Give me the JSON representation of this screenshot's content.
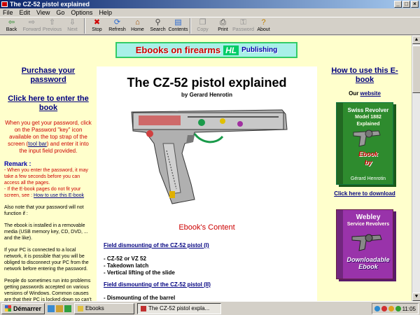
{
  "window": {
    "title": "The CZ-52 pistol explained"
  },
  "menu": [
    "File",
    "Edit",
    "View",
    "Go",
    "Options",
    "Help"
  ],
  "toolbar": [
    {
      "label": "Back",
      "icon": "back-icon",
      "glyph": "⇦",
      "color": "#2a8a2a",
      "enabled": true
    },
    {
      "label": "Forward",
      "icon": "forward-icon",
      "glyph": "⇨",
      "color": "#8c8c8c",
      "enabled": false
    },
    {
      "label": "Previous",
      "icon": "previous-icon",
      "glyph": "⇧",
      "color": "#8c8c8c",
      "enabled": false
    },
    {
      "label": "Next",
      "icon": "next-icon",
      "glyph": "⇩",
      "color": "#8c8c8c",
      "enabled": false
    },
    {
      "label": "Stop",
      "icon": "stop-icon",
      "glyph": "✖",
      "color": "#d00000",
      "enabled": true
    },
    {
      "label": "Refresh",
      "icon": "refresh-icon",
      "glyph": "⟳",
      "color": "#2a6ad0",
      "enabled": true
    },
    {
      "label": "Home",
      "icon": "home-icon",
      "glyph": "⌂",
      "color": "#a05000",
      "enabled": true
    },
    {
      "label": "Search",
      "icon": "search-icon",
      "glyph": "⚲",
      "color": "#404040",
      "enabled": true
    },
    {
      "label": "Contents",
      "icon": "contents-icon",
      "glyph": "▤",
      "color": "#2a6ad0",
      "enabled": true
    },
    {
      "label": "Copy",
      "icon": "copy-icon",
      "glyph": "❐",
      "color": "#8c8c8c",
      "enabled": false
    },
    {
      "label": "Print",
      "icon": "print-icon",
      "glyph": "⎙",
      "color": "#404040",
      "enabled": true
    },
    {
      "label": "Password",
      "icon": "password-icon",
      "glyph": "⚿",
      "color": "#8c8c8c",
      "enabled": false
    },
    {
      "label": "About",
      "icon": "about-icon",
      "glyph": "?",
      "color": "#c08000",
      "enabled": true
    }
  ],
  "banner": {
    "left": "Ebooks on firearms",
    "logo": "HL",
    "right": "Publishing"
  },
  "left": {
    "purchase": "Purchase your password",
    "enter": "Click here to enter the book",
    "instructions_a": "When you get your password, click on the Password \"key\" icon available on the top strap of the screen (",
    "instructions_link": "tool bar",
    "instructions_b": ") and enter it into the input field provided.",
    "remark_title": "Remark :",
    "remark_1": "- When you enter the password, it may take a few seconds before you can access all the pages.",
    "remark_2a": "- If the E-book pages do not fit your screen, see : ",
    "remark_2_link": "How to use this E-book",
    "note_1": "Also note that your password will not function if :",
    "note_2": "The ebook is installed in a removable media (USB memory key, CD, DVD, ... and the like).",
    "note_3": "If your PC is connected to a local network, it is possible that you will be obliged to disconnect your PC from the network before entering the password.",
    "note_4": "People do sometimes run into problems getting passwords accepted on various versions of Windows. Common causes are that their PC is locked down so can't store the password, or some kind of anti-virus or security software is blocking the password being stored."
  },
  "center": {
    "title": "The CZ-52 pistol explained",
    "author": "by Gerard Henrotin",
    "contents_title": "Ebook's Content",
    "section1": "Field dismounting of the CZ-52 pistol (I)",
    "bullets1": [
      "- CZ-52 or VZ 52",
      "- Takedown latch",
      "- Vertical lifting of the slide"
    ],
    "section2": "Field dismounting of the CZ-52 pistol (II)",
    "bullets2": [
      "- Dismounting of the barrel"
    ]
  },
  "right": {
    "how_to": "How to use this E-book",
    "our_prefix": "Our ",
    "our_link": "website",
    "book1": {
      "title": "Swiss Revolver",
      "sub": "Model 1882 Explained",
      "red": "Ebook",
      "by": "by",
      "author": "Gérard Henrotin",
      "spine": "H&L Publishing"
    },
    "download": "Click here to download",
    "book2": {
      "title": "Webley",
      "sub": "Service Revolvers",
      "red": "Downloadable Ebook",
      "spine": "Ebooks - H&L Publishing"
    }
  },
  "taskbar": {
    "start": "Démarrer",
    "task1": "Ebooks",
    "task2": "The CZ-52 pistol expla...",
    "clock": "11:05"
  }
}
